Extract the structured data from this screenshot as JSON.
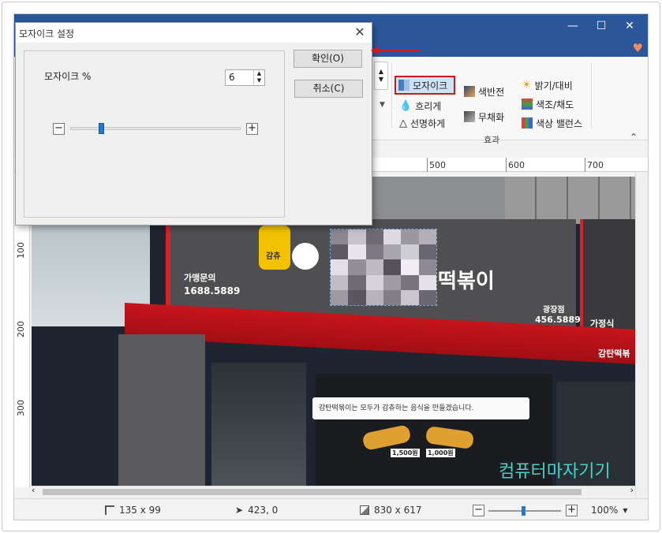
{
  "window": {
    "minimize_glyph": "—",
    "maximize_glyph": "☐",
    "close_glyph": "✕",
    "heart_glyph": "♥"
  },
  "ribbon": {
    "mosaic": "모자이크",
    "blur": "흐리게",
    "sharpen": "선명하게",
    "invert": "색반전",
    "desaturate": "무채화",
    "brightness": "밝기/대비",
    "hue": "색조/채도",
    "color_balance": "색상 밸런스",
    "effects_group": "효과",
    "collapse_glyph": "⌃"
  },
  "ruler": {
    "top": [
      "500",
      "600",
      "700"
    ],
    "left": [
      "100",
      "200",
      "300"
    ]
  },
  "photo": {
    "sign_menu": "떡볶이",
    "sign_phone_left_1": "가맹문의",
    "sign_phone_left_2": "1688.5889",
    "sign_branch": "광장점",
    "sign_branch_phone": "456.5889",
    "sign_right": "가정식",
    "awning_right": "감탄떡볶",
    "banner": "감탄떡볶이는 모두가 감츄하는 음식을 만들겠습니다.",
    "price_1": "1,500원",
    "price_2": "1,000원",
    "watermark": "컴퓨터마자기기",
    "logo_word": "감츄"
  },
  "status": {
    "selection_size": "135 x 99",
    "cursor_pos": "423, 0",
    "image_size": "830 x 617",
    "zoom": "100%"
  },
  "dialog": {
    "title": "모자이크 설정",
    "percent_label": "모자이크 %",
    "percent_value": "6",
    "ok": "확인(O)",
    "cancel": "취소(C)",
    "minus": "−",
    "plus": "+",
    "slider_fraction": 0.06
  },
  "colors": {
    "accent": "#2b579a",
    "highlight": "#d4151c",
    "arrow": "#d4151c"
  }
}
